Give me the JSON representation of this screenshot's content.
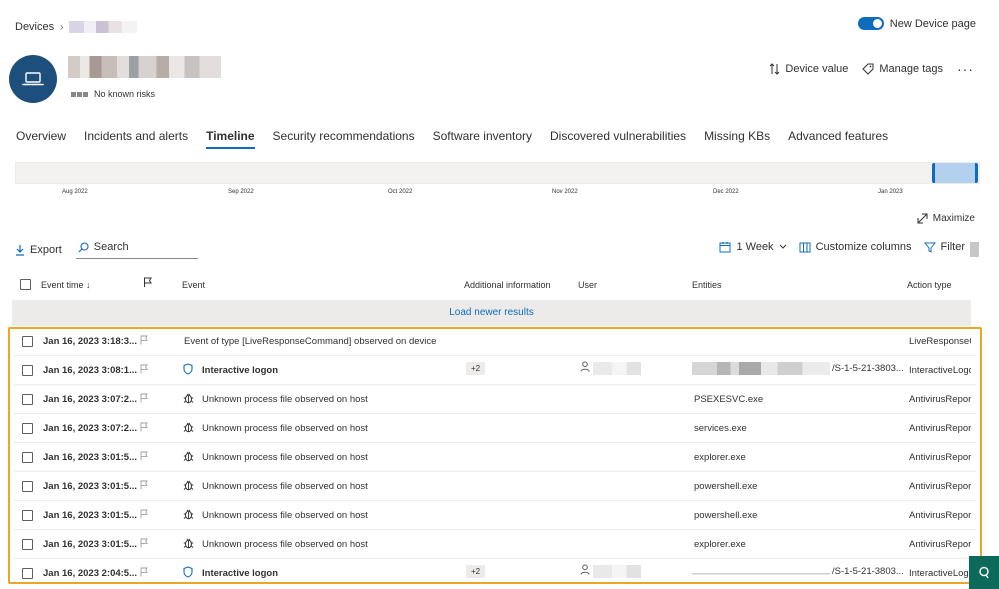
{
  "breadcrumb": {
    "root": "Devices"
  },
  "toggle": {
    "label": "New Device page",
    "on": true
  },
  "device": {
    "risk_label": "No known risks"
  },
  "header_actions": {
    "device_value": "Device value",
    "manage_tags": "Manage tags",
    "more": "···"
  },
  "tabs": [
    {
      "label": "Overview",
      "active": false
    },
    {
      "label": "Incidents and alerts",
      "active": false
    },
    {
      "label": "Timeline",
      "active": true
    },
    {
      "label": "Security recommendations",
      "active": false
    },
    {
      "label": "Software inventory",
      "active": false
    },
    {
      "label": "Discovered vulnerabilities",
      "active": false
    },
    {
      "label": "Missing KBs",
      "active": false
    },
    {
      "label": "Advanced features",
      "active": false
    }
  ],
  "timeline": {
    "months": [
      "Aug 2022",
      "Sep 2022",
      "Oct 2022",
      "Nov 2022",
      "Dec 2022",
      "Jan 2023"
    ]
  },
  "maximize": "Maximize",
  "toolbar": {
    "export": "Export",
    "search_placeholder": "Search",
    "range": "1 Week",
    "customize_columns": "Customize columns",
    "filter": "Filter"
  },
  "columns": {
    "event_time": "Event time",
    "event": "Event",
    "additional_info": "Additional information",
    "user": "User",
    "entities": "Entities",
    "action_type": "Action type"
  },
  "load_newer": "Load newer results",
  "rows": [
    {
      "time": "Jan 16, 2023 3:18:3...",
      "icon": "",
      "event": "Event of type [LiveResponseCommand] observed on device",
      "bold": false,
      "extra": "",
      "user": false,
      "entity": "",
      "action": "LiveResponseC"
    },
    {
      "time": "Jan 16, 2023 3:08:1...",
      "icon": "shield-icon",
      "event": "Interactive logon",
      "bold": true,
      "extra": "+2",
      "user": true,
      "entity": "/S-1-5-21-3803...",
      "action": "InteractiveLogo"
    },
    {
      "time": "Jan 16, 2023 3:07:2...",
      "icon": "bug-icon",
      "event": "Unknown process file observed on host",
      "bold": false,
      "extra": "",
      "user": false,
      "entity": "PSEXESVC.exe",
      "action": "AntivirusRepor"
    },
    {
      "time": "Jan 16, 2023 3:07:2...",
      "icon": "bug-icon",
      "event": "Unknown process file observed on host",
      "bold": false,
      "extra": "",
      "user": false,
      "entity": "services.exe",
      "action": "AntivirusRepor"
    },
    {
      "time": "Jan 16, 2023 3:01:5...",
      "icon": "bug-icon",
      "event": "Unknown process file observed on host",
      "bold": false,
      "extra": "",
      "user": false,
      "entity": "explorer.exe",
      "action": "AntivirusRepor"
    },
    {
      "time": "Jan 16, 2023 3:01:5...",
      "icon": "bug-icon",
      "event": "Unknown process file observed on host",
      "bold": false,
      "extra": "",
      "user": false,
      "entity": "powershell.exe",
      "action": "AntivirusRepor"
    },
    {
      "time": "Jan 16, 2023 3:01:5...",
      "icon": "bug-icon",
      "event": "Unknown process file observed on host",
      "bold": false,
      "extra": "",
      "user": false,
      "entity": "powershell.exe",
      "action": "AntivirusRepor"
    },
    {
      "time": "Jan 16, 2023 3:01:5...",
      "icon": "bug-icon",
      "event": "Unknown process file observed on host",
      "bold": false,
      "extra": "",
      "user": false,
      "entity": "explorer.exe",
      "action": "AntivirusRepor"
    },
    {
      "time": "Jan 16, 2023 2:04:5...",
      "icon": "shield-icon",
      "event": "Interactive logon",
      "bold": true,
      "extra": "+2",
      "user": true,
      "entity": "/S-1-5-21-3803...",
      "action": "InteractiveLogo"
    }
  ],
  "colors": {
    "accent": "#0f6cbd",
    "highlight_border": "#e8a825",
    "device_avatar": "#1d4f7c"
  }
}
